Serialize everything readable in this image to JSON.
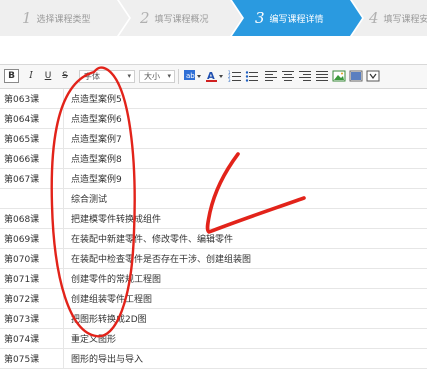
{
  "wizard": {
    "steps": [
      {
        "num": "1",
        "label": "选择课程类型",
        "active": false
      },
      {
        "num": "2",
        "label": "填写课程概况",
        "active": false
      },
      {
        "num": "3",
        "label": "编写课程详情",
        "active": true
      },
      {
        "num": "4",
        "label": "填写课程安排",
        "active": false
      }
    ],
    "active_color": "#2a9ae0",
    "inactive_color": "#efefef"
  },
  "toolbar": {
    "bold": "B",
    "italic": "I",
    "underline": "U",
    "strike": "S",
    "font_family_value": "字体",
    "font_size_value": "大小",
    "icons": [
      "highlight-color-icon",
      "font-color-icon",
      "ordered-list-icon",
      "unordered-list-icon",
      "align-left-icon",
      "align-center-icon",
      "align-right-icon",
      "align-justify-icon",
      "insert-image-icon",
      "insert-video-icon",
      "code-icon"
    ]
  },
  "lessons": [
    {
      "num": "第063课",
      "title": "点造型案例5"
    },
    {
      "num": "第064课",
      "title": "点造型案例6"
    },
    {
      "num": "第065课",
      "title": "点造型案例7"
    },
    {
      "num": "第066课",
      "title": "点造型案例8"
    },
    {
      "num": "第067课",
      "title": "点造型案例9"
    },
    {
      "num": "",
      "title": "综合测试"
    },
    {
      "num": "第068课",
      "title": "把建模零件转换成组件"
    },
    {
      "num": "第069课",
      "title": "在装配中新建零件、修改零件、编辑零件"
    },
    {
      "num": "第070课",
      "title": "在装配中检查零件是否存在干涉、创建组装图"
    },
    {
      "num": "第071课",
      "title": "创建零件的常规工程图"
    },
    {
      "num": "第072课",
      "title": "创建组装零件工程图"
    },
    {
      "num": "第073课",
      "title": "把图形转换成2D图"
    },
    {
      "num": "第074课",
      "title": "重定义图形"
    },
    {
      "num": "第075课",
      "title": "图形的导出与导入"
    }
  ],
  "annotation_color": "#e2231a"
}
